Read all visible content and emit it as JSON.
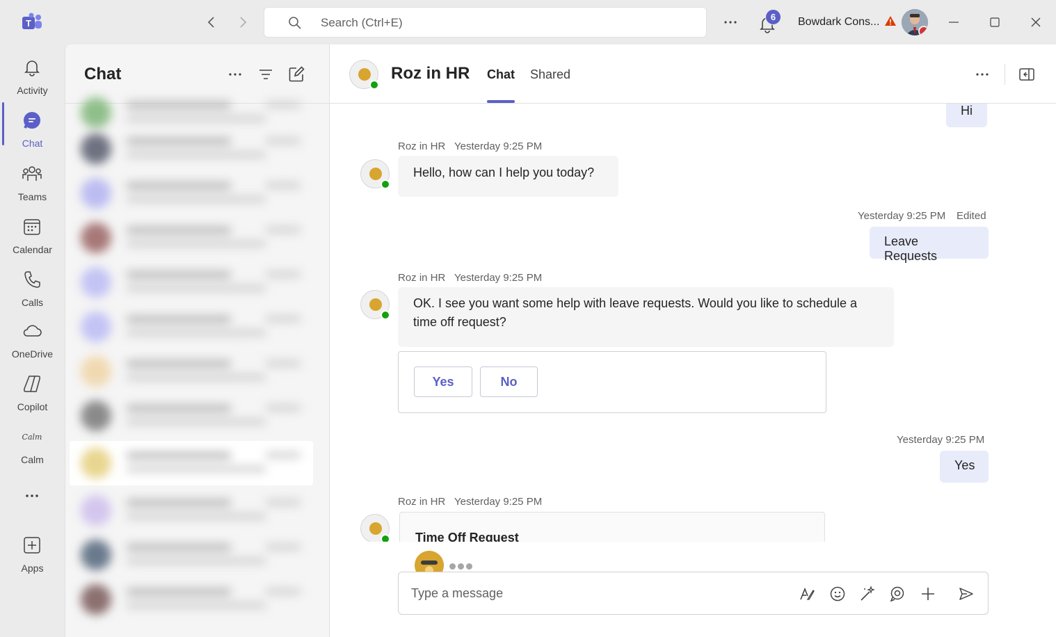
{
  "titlebar": {
    "search_placeholder": "Search (Ctrl+E)",
    "notification_count": "6",
    "org_name": "Bowdark Cons..."
  },
  "rail": {
    "items": [
      {
        "label": "Activity",
        "icon": "bell-icon"
      },
      {
        "label": "Chat",
        "icon": "chat-icon"
      },
      {
        "label": "Teams",
        "icon": "teams-icon"
      },
      {
        "label": "Calendar",
        "icon": "calendar-icon"
      },
      {
        "label": "Calls",
        "icon": "phone-icon"
      },
      {
        "label": "OneDrive",
        "icon": "cloud-icon"
      },
      {
        "label": "Copilot",
        "icon": "copilot-icon"
      },
      {
        "label": "Calm",
        "icon": "calm-icon"
      },
      {
        "label": "Apps",
        "icon": "add-apps-icon"
      }
    ]
  },
  "list": {
    "title": "Chat"
  },
  "chat_header": {
    "name": "Roz in HR",
    "tabs": [
      "Chat",
      "Shared"
    ]
  },
  "messages": {
    "m1_text": "Hi",
    "m2_sender": "Roz in HR",
    "m2_time": "Yesterday 9:25 PM",
    "m2_text": "Hello, how can I help you today?",
    "m3_time": "Yesterday 9:25 PM",
    "m3_edited": "Edited",
    "m3_text": "Leave Requests",
    "m4_sender": "Roz in HR",
    "m4_time": "Yesterday 9:25 PM",
    "m4_text": "OK. I see you want some help with leave requests. Would you like to schedule a time off request?",
    "m4_btn_yes": "Yes",
    "m4_btn_no": "No",
    "m5_time": "Yesterday 9:25 PM",
    "m5_text": "Yes",
    "m6_sender": "Roz in HR",
    "m6_time": "Yesterday 9:25 PM",
    "m6_card_title": "Time Off Request"
  },
  "composer": {
    "placeholder": "Type a message"
  },
  "colors": {
    "accent": "#5b5fc7",
    "presence_available": "#13a10e",
    "presence_busy": "#d13438",
    "outgoing_bubble": "#e8ebfa",
    "incoming_bubble": "#f5f5f5"
  }
}
